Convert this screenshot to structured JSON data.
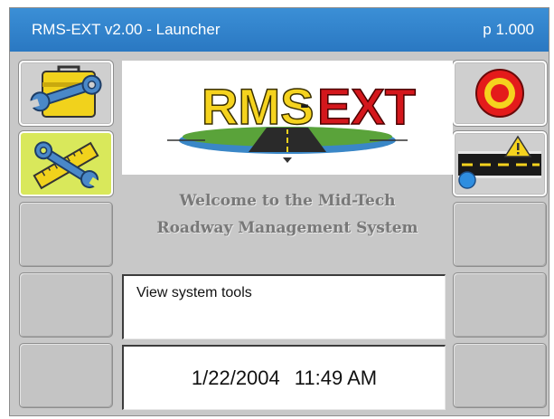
{
  "window": {
    "title": "RMS-EXT v2.00 - Launcher",
    "page_indicator": "p 1.000"
  },
  "logo": {
    "text_left": "RMS",
    "separator": "-",
    "text_right": "EXT"
  },
  "welcome": {
    "line1": "Welcome to the Mid-Tech",
    "line2": "Roadway Management System"
  },
  "description": {
    "text": "View system tools"
  },
  "status": {
    "date": "1/22/2004",
    "time": "11:49 AM"
  },
  "left_buttons": [
    {
      "icon": "toolbox-wrench-icon",
      "state": "normal"
    },
    {
      "icon": "ruler-wrench-icon",
      "state": "selected",
      "highlight_color": "#d9e85b"
    },
    {
      "icon": null
    },
    {
      "icon": null
    },
    {
      "icon": null
    }
  ],
  "right_buttons": [
    {
      "icon": "target-icon"
    },
    {
      "icon": "road-warning-icon"
    },
    {
      "icon": null
    },
    {
      "icon": null
    },
    {
      "icon": null
    }
  ],
  "colors": {
    "titlebar": "#2a78c2",
    "background": "#c8c8c8",
    "selected_tile": "#d9e85b"
  }
}
